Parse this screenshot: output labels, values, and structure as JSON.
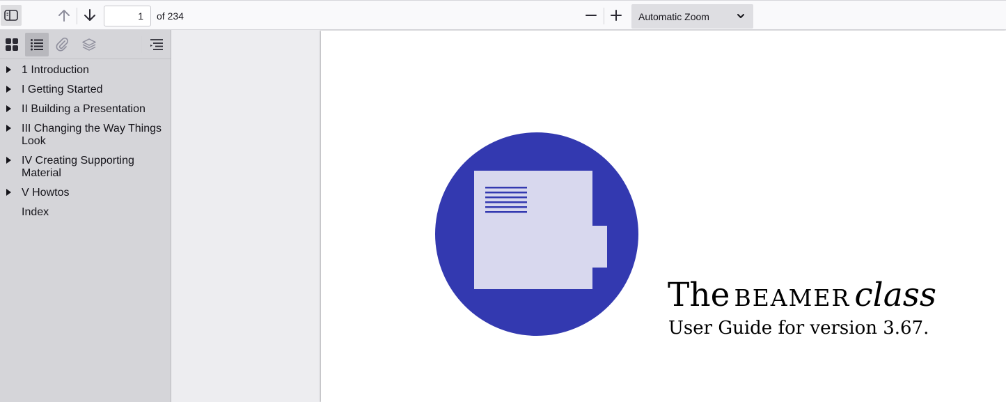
{
  "toolbar": {
    "page_number": "1",
    "page_total": "of 234",
    "zoom": "Automatic Zoom"
  },
  "sidebar": {
    "outline": [
      {
        "label": "1 Introduction",
        "expandable": true
      },
      {
        "label": "I Getting Started",
        "expandable": true
      },
      {
        "label": "II Building a Presentation",
        "expandable": true
      },
      {
        "label": "III Changing the Way Things Look",
        "expandable": true
      },
      {
        "label": "IV Creating Supporting Material",
        "expandable": true
      },
      {
        "label": "V Howtos",
        "expandable": true
      },
      {
        "label": "Index",
        "expandable": false
      }
    ]
  },
  "document": {
    "title_the": "The",
    "title_beamer": "beamer",
    "title_class": "class",
    "subtitle": "User Guide for version 3.67.",
    "logo_colors": {
      "circle": "#3339b0",
      "sheet": "#d8d8ee",
      "lines": "#3339b0"
    }
  }
}
